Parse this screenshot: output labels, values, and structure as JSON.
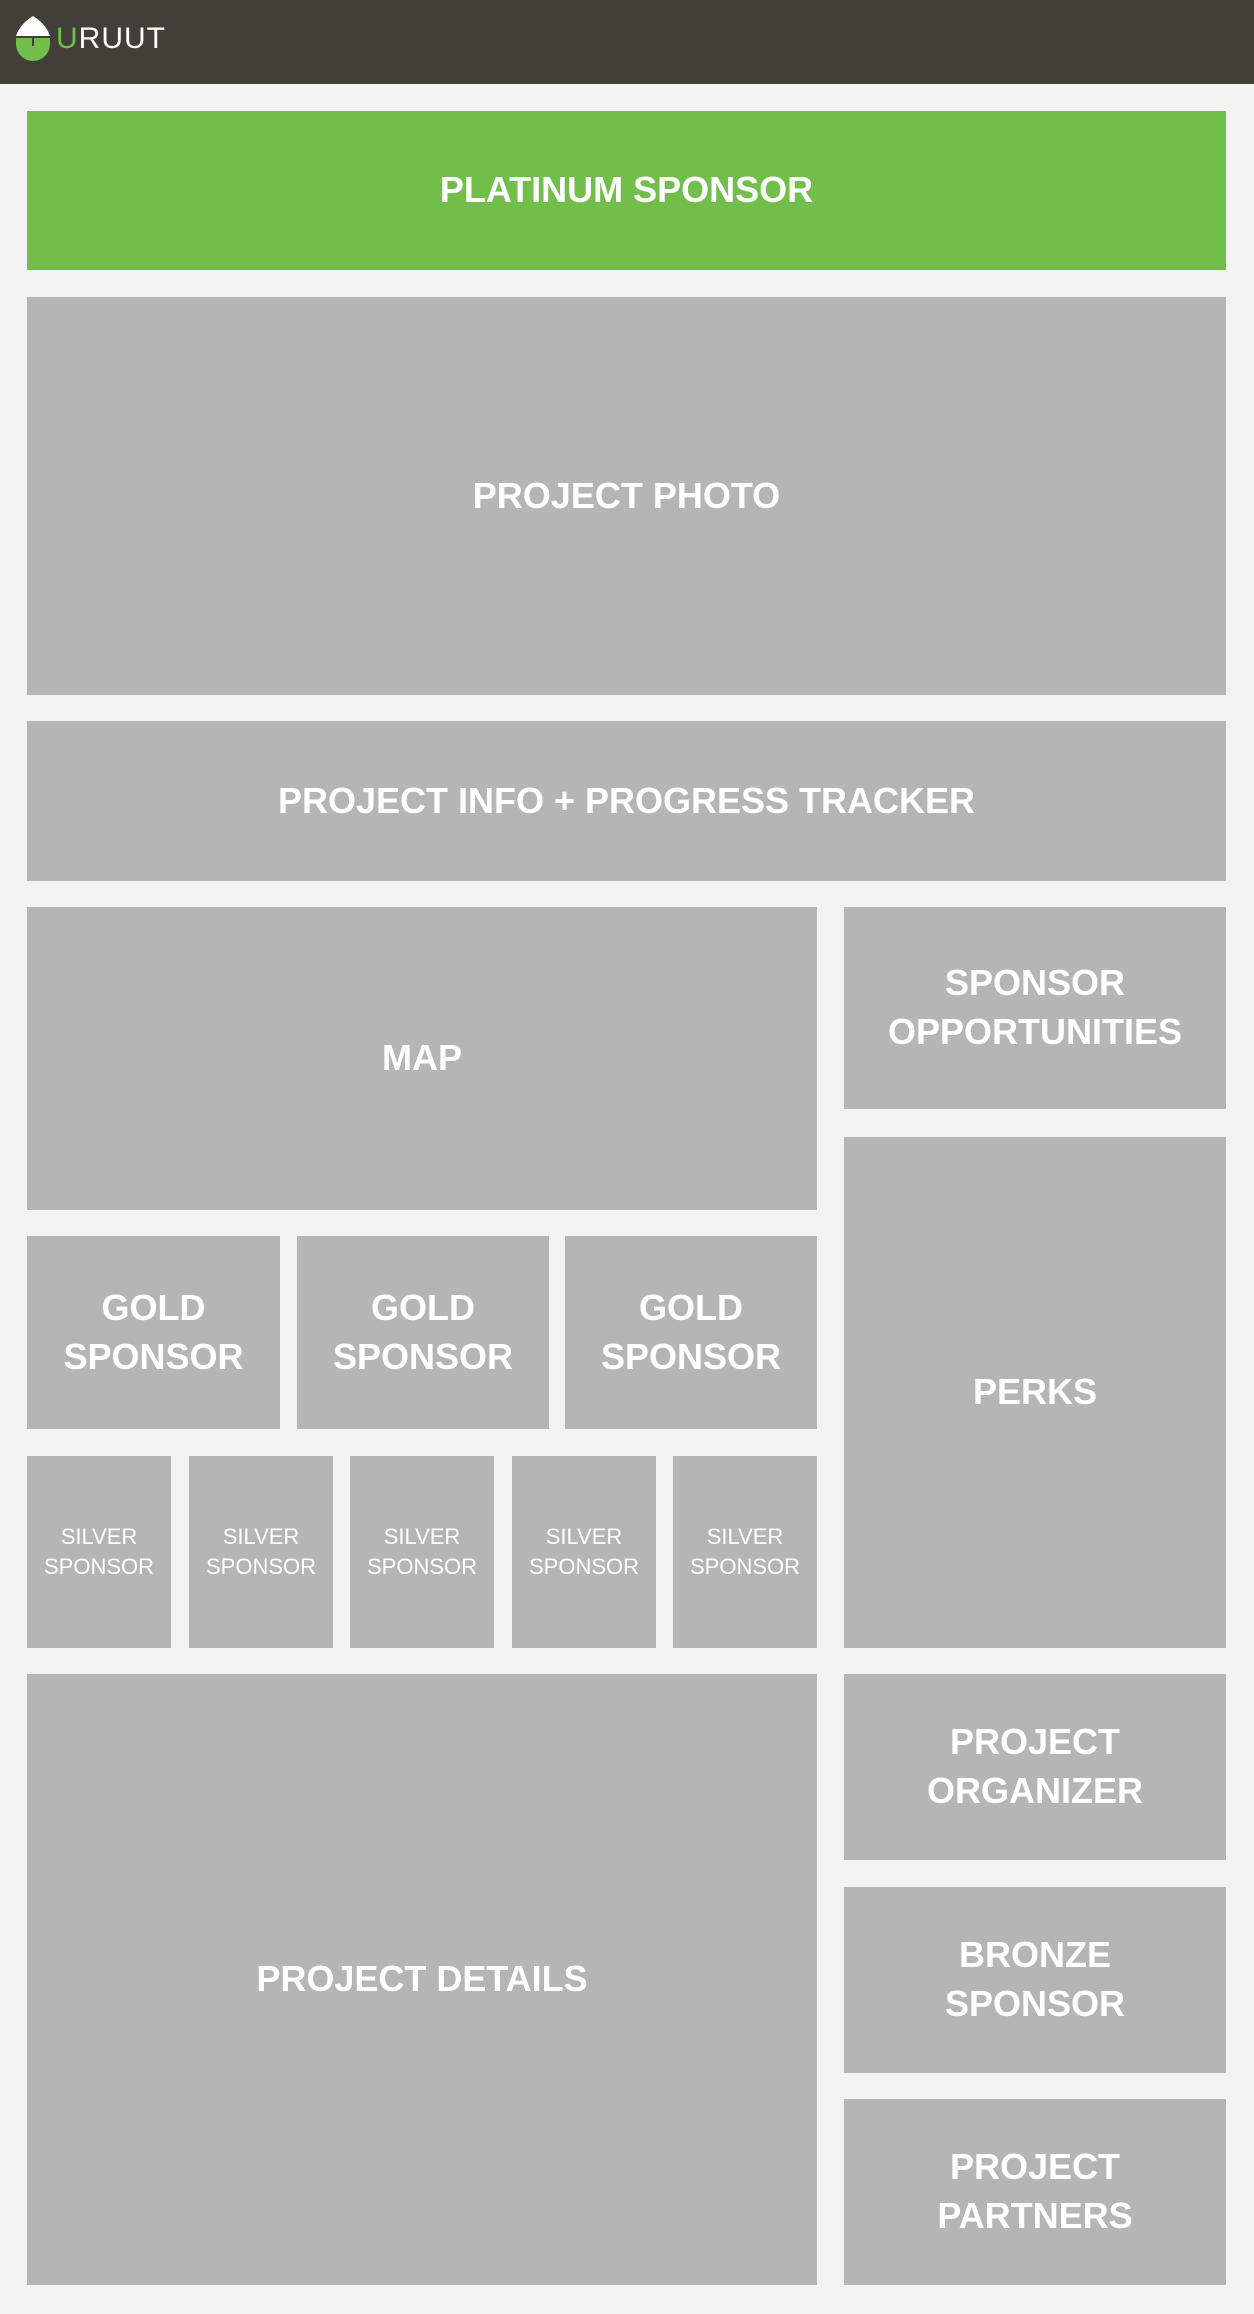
{
  "header": {
    "brand_first": "U",
    "brand_rest": "RUUT"
  },
  "colors": {
    "accent": "#72be4b",
    "header": "#423f38",
    "block": "#b5b5b4",
    "background": "#f3f3f3"
  },
  "blocks": {
    "platinum": "PLATINUM SPONSOR",
    "photo": "PROJECT PHOTO",
    "info": "PROJECT INFO + PROGRESS TRACKER",
    "map": "MAP",
    "sponsor_opportunities": "SPONSOR\nOPPORTUNITIES",
    "perks": "PERKS",
    "gold": [
      "GOLD\nSPONSOR",
      "GOLD\nSPONSOR",
      "GOLD\nSPONSOR"
    ],
    "silver": [
      "SILVER\nSPONSOR",
      "SILVER\nSPONSOR",
      "SILVER\nSPONSOR",
      "SILVER\nSPONSOR",
      "SILVER\nSPONSOR"
    ],
    "details": "PROJECT DETAILS",
    "organizer": "PROJECT\nORGANIZER",
    "bronze": "BRONZE\nSPONSOR",
    "partners": "PROJECT\nPARTNERS"
  }
}
